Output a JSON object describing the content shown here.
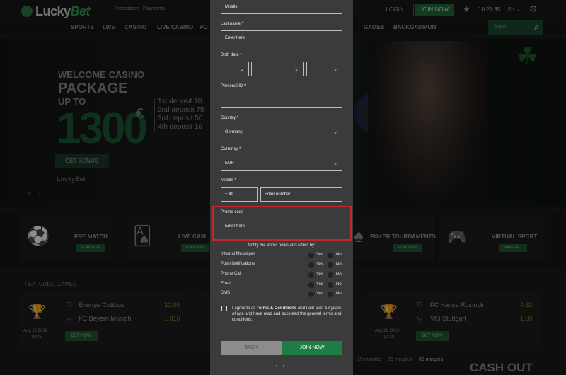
{
  "site": {
    "logo_lucky": "Lucky",
    "logo_bet": "Bet",
    "top_links": [
      "Promotions",
      "Payments"
    ],
    "login_label": "LOGIN",
    "join_label": "JOIN NOW",
    "clock": "10:21:35",
    "language": "EN",
    "nav": [
      "SPORTS",
      "LIVE",
      "CASINO",
      "LIVE CASINO",
      "PO",
      "GAMES",
      "BACKGAMMON"
    ],
    "search_placeholder": "Search"
  },
  "hero": {
    "line1": "WELCOME CASINO",
    "line2": "PACKAGE",
    "line3": "UP TO",
    "amount": "1300",
    "currency": "€",
    "deposits": [
      "1st deposit 10",
      "2nd deposit 75",
      "3rd deposit 50",
      "4th deposit 10"
    ],
    "cta": "GET BONUS",
    "small_logo": "LuckyBet"
  },
  "categories": [
    {
      "label": "PRE MATCH",
      "btn": "PLAY NOW"
    },
    {
      "label": "LIVE CASI",
      "btn": "PLAY NOW"
    },
    {
      "label": "POKER TOURNAMENTS",
      "btn": "PLAY NOW"
    },
    {
      "label": "VIRTUAL SPORT",
      "btn": "MAKE BET"
    }
  ],
  "featured_title": "FEATURED GAMES",
  "games": [
    {
      "team1": "Energie Cottbus",
      "odd1": "30.00",
      "team2": "FC Bayern Munich",
      "odd2": "1.016",
      "date": "Aug 12 2019",
      "time": "19:45",
      "btn": "BET NOW"
    },
    {
      "team1": "FC Hansa Rostock",
      "odd1": "4.53",
      "team2": "VfB Stuttgart",
      "odd2": "1.69",
      "date": "Aug 12 2019",
      "time": "17:30",
      "btn": "BET NOW"
    }
  ],
  "cashout": "CASH OUT",
  "minute_tabs": [
    "15 minutes",
    "30 minutes",
    "60 minutes"
  ],
  "form": {
    "middle_value": "Middle",
    "last_name_label": "Last name *",
    "last_name_placeholder": "Enter here",
    "birth_label": "Birth date *",
    "personal_id_label": "Personal ID *",
    "country_label": "Country *",
    "country_value": "Germany",
    "currency_label": "Currency *",
    "currency_value": "EUR",
    "mobile_label": "Mobile *",
    "mobile_code": "+ 49",
    "mobile_placeholder": "Enter number",
    "promo_label": "Promo code",
    "promo_placeholder": "Enter here",
    "notify_title": "Notify me about news and offers by:",
    "notify_rows": [
      "Internal Messages",
      "Push Notifications",
      "Phone Call",
      "Email",
      "SMS"
    ],
    "yes": "Yes",
    "no": "No",
    "agree_pre": "I agree to all ",
    "agree_terms": "Terms & Conditions",
    "agree_post": " and I am over 18 years of age and have read and accepted the general terms and conditions.",
    "back_label": "BACK",
    "join_label": "JOIN NOW",
    "pager": "• •"
  },
  "colors": {
    "accent": "#1e7d44",
    "highlight": "#c8262d",
    "modal_bg": "#3b3b3b"
  }
}
